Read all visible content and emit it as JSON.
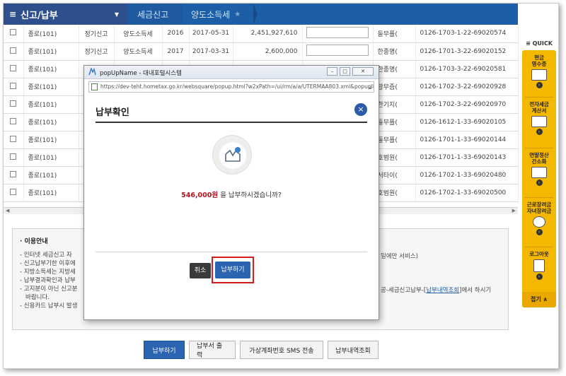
{
  "breadcrumb": {
    "menu_label": "신고/납부",
    "crumb1": "세금신고",
    "crumb2": "양도소득세"
  },
  "table": {
    "rows": [
      {
        "office": "종로(101)",
        "type": "정기신고",
        "tax": "양도소득세",
        "year": "2016",
        "date": "2017-05-31",
        "amount": "2,451,927,610",
        "name": "들무플(",
        "no": "0126-1703-1-22-69020574"
      },
      {
        "office": "종로(101)",
        "type": "정기신고",
        "tax": "양도소득세",
        "year": "2017",
        "date": "2017-03-31",
        "amount": "2,600,000",
        "name": "한종명(",
        "no": "0126-1701-3-22-69020152"
      },
      {
        "office": "종로(101)",
        "type": "",
        "tax": "",
        "year": "",
        "date": "",
        "amount": "",
        "name": "한종명(",
        "no": "0126-1703-3-22-69020581"
      },
      {
        "office": "종로(101)",
        "type": "",
        "tax": "",
        "year": "",
        "date": "",
        "amount": "",
        "name": "광무즘(",
        "no": "0126-1702-3-22-69020928"
      },
      {
        "office": "종로(101)",
        "type": "",
        "tax": "",
        "year": "",
        "date": "",
        "amount": "",
        "name": "한기지(",
        "no": "0126-1702-3-22-69020970"
      },
      {
        "office": "종로(101)",
        "type": "",
        "tax": "",
        "year": "",
        "date": "",
        "amount": "",
        "name": "들무플(",
        "no": "0126-1612-1-33-69020105"
      },
      {
        "office": "종로(101)",
        "type": "",
        "tax": "",
        "year": "",
        "date": "",
        "amount": "",
        "name": "들무플(",
        "no": "0126-1701-1-33-69020144"
      },
      {
        "office": "종로(101)",
        "type": "",
        "tax": "",
        "year": "",
        "date": "",
        "amount": "",
        "name": "호범원(",
        "no": "0126-1701-1-33-69020143"
      },
      {
        "office": "종로(101)",
        "type": "",
        "tax": "",
        "year": "",
        "date": "",
        "amount": "",
        "name": "서타이(",
        "no": "0126-1702-1-33-69020480"
      },
      {
        "office": "종로(101)",
        "type": "",
        "tax": "",
        "year": "",
        "date": "",
        "amount": "",
        "name": "호범원(",
        "no": "0126-1702-1-33-69020500"
      }
    ]
  },
  "info": {
    "title": "· 이용안내",
    "lines": [
      "- 인터넷 세금신고 자",
      "- 신고납부기한 이후에",
      "- 지방소득세는 지방세",
      "- 납부결과확인과 납부",
      "- 고지분이 아닌 신고분",
      "  바랍니다.",
      "- 신용카드 납부시 발생"
    ],
    "line1_tail": "일에만 서비스)",
    "line5_tail_a": "공-세금신고납부-[",
    "line5_link": "납부내역조회",
    "line5_tail_b": "]에서 하시기"
  },
  "buttons": {
    "pay": "납부하기",
    "print": "납부서 출력",
    "sms": "가상계좌번호 SMS 전송",
    "history": "납부내역조회"
  },
  "quick": {
    "head": "≡ QUICK",
    "items": [
      "현금\n영수증",
      "전자세금\n계산서",
      "연말정산\n간소화",
      "근로장려금\n자녀장려금",
      "로그아웃"
    ],
    "fold": "접기 ∧"
  },
  "popup": {
    "window_title": "popUpName - 대내포털시스템",
    "url": "https://dev-teht.hometax.go.kr/websquare/popup.html?w2xPath=/ui/rm/a/a/UTERMAA803.xml&popupID=L",
    "heading": "납부확인",
    "amount": "546,000원",
    "message": " 을 납부하시겠습니까?",
    "cancel": "취소",
    "confirm": "납부하기"
  },
  "colors": {
    "topbar": "#1c5fa6",
    "menu": "#2d4f8c",
    "quick": "#f5b800",
    "amount": "#b8161c",
    "highlight": "#d21e1e"
  }
}
